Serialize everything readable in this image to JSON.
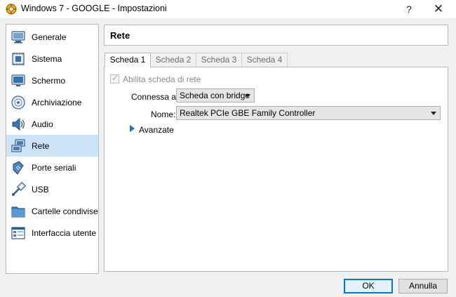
{
  "window": {
    "title": "Windows 7 - GOOGLE - Impostazioni",
    "help_label": "?",
    "close_label": "✕"
  },
  "sidebar": {
    "items": [
      {
        "label": "Generale",
        "icon": "monitor-icon",
        "active": false
      },
      {
        "label": "Sistema",
        "icon": "chip-icon",
        "active": false
      },
      {
        "label": "Schermo",
        "icon": "display-icon",
        "active": false
      },
      {
        "label": "Archiviazione",
        "icon": "disk-icon",
        "active": false
      },
      {
        "label": "Audio",
        "icon": "speaker-icon",
        "active": false
      },
      {
        "label": "Rete",
        "icon": "network-icon",
        "active": true
      },
      {
        "label": "Porte seriali",
        "icon": "serial-port-icon",
        "active": false
      },
      {
        "label": "USB",
        "icon": "usb-icon",
        "active": false
      },
      {
        "label": "Cartelle condivise",
        "icon": "folder-icon",
        "active": false
      },
      {
        "label": "Interfaccia utente",
        "icon": "ui-window-icon",
        "active": false
      }
    ]
  },
  "main": {
    "title": "Rete",
    "tabs": [
      {
        "label": "Scheda 1",
        "active": true
      },
      {
        "label": "Scheda 2",
        "active": false
      },
      {
        "label": "Scheda 3",
        "active": false
      },
      {
        "label": "Scheda 4",
        "active": false
      }
    ],
    "enable_adapter": {
      "label": "Abilita scheda di rete",
      "checked": true,
      "disabled": true
    },
    "attached_to": {
      "label": "Connessa a:",
      "value": "Scheda con bridge"
    },
    "name": {
      "label": "Nome:",
      "value": "Realtek PCIe GBE Family Controller"
    },
    "advanced": {
      "label": "Avanzate"
    }
  },
  "buttons": {
    "ok": "OK",
    "cancel": "Annulla"
  },
  "colors": {
    "selection": "#cce4f7",
    "accent": "#0078d7",
    "expander": "#1f6fc5"
  }
}
